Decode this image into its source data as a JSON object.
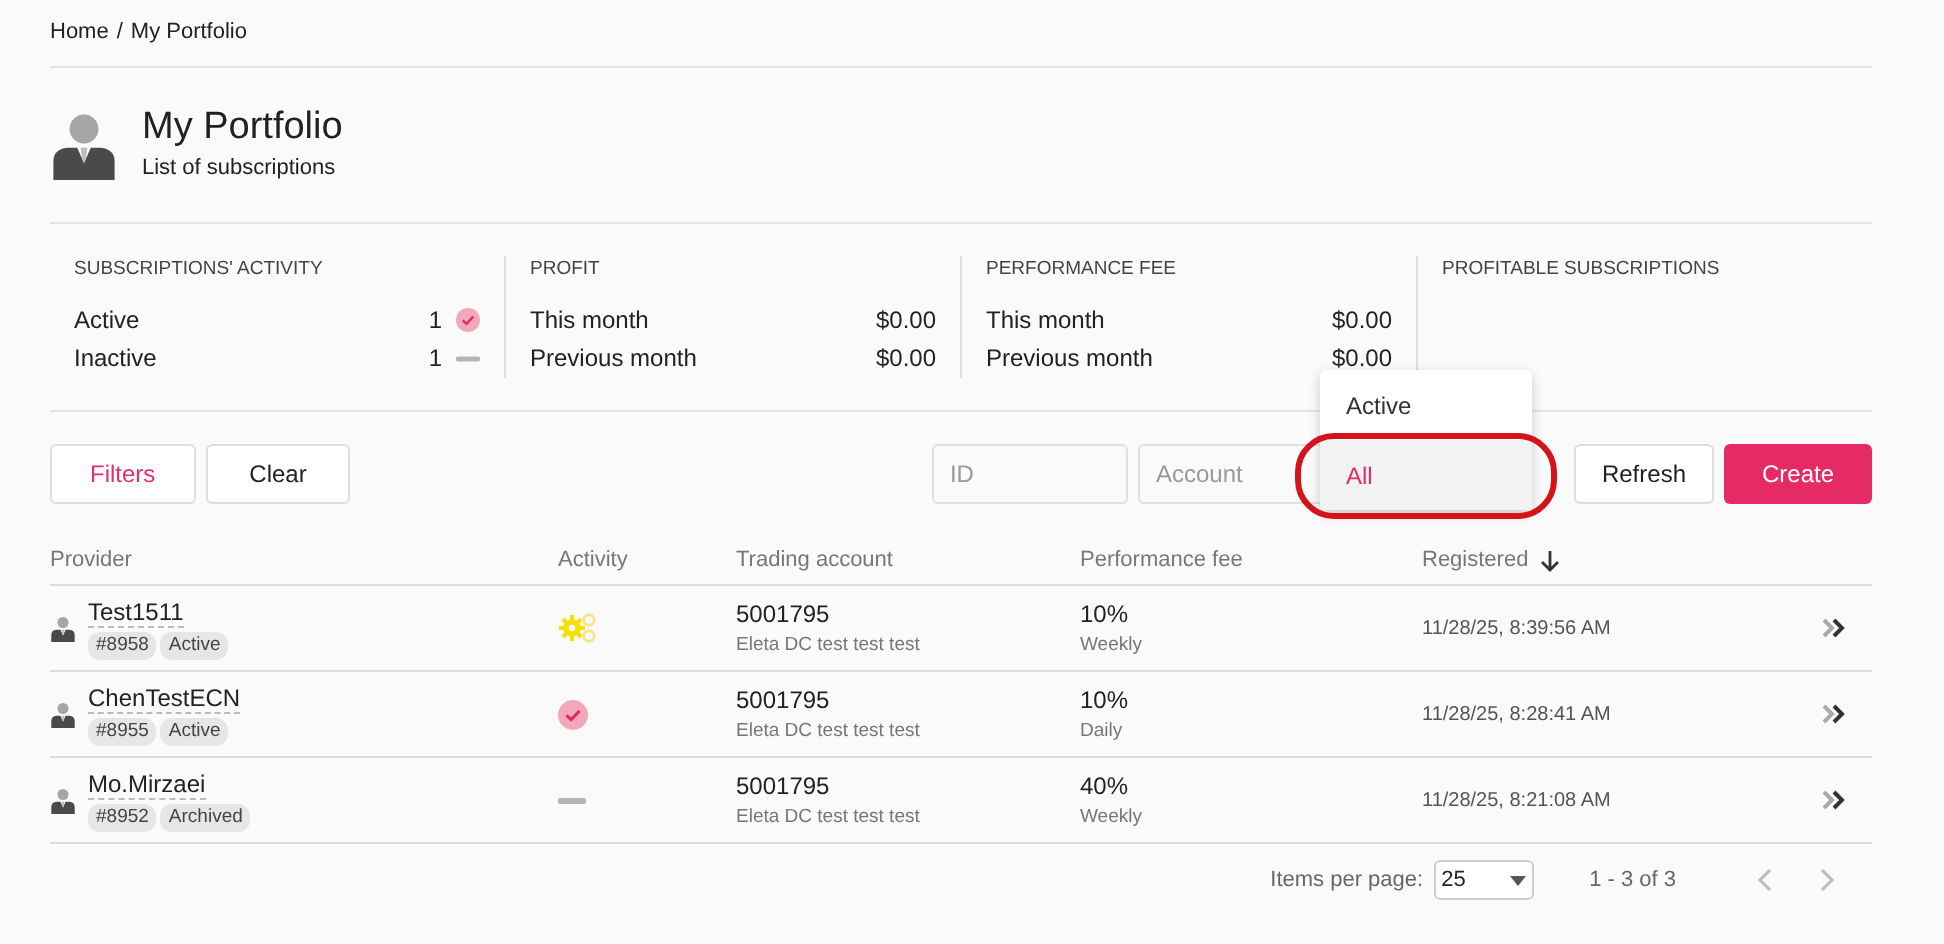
{
  "breadcrumb": {
    "items": [
      "Home",
      "My Portfolio"
    ],
    "separator": "/"
  },
  "header": {
    "title": "My Portfolio",
    "subtitle": "List of subscriptions"
  },
  "stats": [
    {
      "heading": "SUBSCRIPTIONS' ACTIVITY",
      "rows": [
        {
          "label": "Active",
          "value": "1",
          "kind": "active"
        },
        {
          "label": "Inactive",
          "value": "1",
          "kind": "inactive"
        }
      ]
    },
    {
      "heading": "PROFIT",
      "rows": [
        {
          "label": "This month",
          "value": "$0.00",
          "kind": "plain"
        },
        {
          "label": "Previous month",
          "value": "$0.00",
          "kind": "plain"
        }
      ]
    },
    {
      "heading": "PERFORMANCE FEE",
      "rows": [
        {
          "label": "This month",
          "value": "$0.00",
          "kind": "plain"
        },
        {
          "label": "Previous month",
          "value": "$0.00",
          "kind": "plain"
        }
      ]
    },
    {
      "heading": "PROFITABLE SUBSCRIPTIONS"
    }
  ],
  "toolbar": {
    "filters": "Filters",
    "clear": "Clear",
    "id_placeholder": "ID",
    "account_placeholder": "Account",
    "refresh": "Refresh",
    "create": "Create"
  },
  "status_dropdown": {
    "options": [
      {
        "label": "Active",
        "selected": false
      },
      {
        "label": "All",
        "selected": true
      }
    ]
  },
  "table": {
    "columns": [
      {
        "label": "Provider",
        "sorted": false
      },
      {
        "label": "Activity",
        "sorted": false
      },
      {
        "label": "Trading account",
        "sorted": false
      },
      {
        "label": "Performance fee",
        "sorted": false
      },
      {
        "label": "Registered",
        "sorted": true
      }
    ],
    "rows": [
      {
        "name": "Test1511",
        "id": "#8958",
        "status": "Active",
        "activity": {
          "kind": "running"
        },
        "account": "5001795",
        "account_name": "Eleta DC test test test",
        "fee": "10%",
        "period": "Weekly",
        "registered": "11/28/25, 8:39:56 AM"
      },
      {
        "name": "ChenTestECN",
        "id": "#8955",
        "status": "Active",
        "activity": {
          "kind": "active"
        },
        "account": "5001795",
        "account_name": "Eleta DC test test test",
        "fee": "10%",
        "period": "Daily",
        "registered": "11/28/25, 8:28:41 AM"
      },
      {
        "name": "Mo.Mirzaei",
        "id": "#8952",
        "status": "Archived",
        "activity": {
          "kind": "inactive"
        },
        "account": "5001795",
        "account_name": "Eleta DC test test test",
        "fee": "40%",
        "period": "Weekly",
        "registered": "11/28/25, 8:21:08 AM"
      }
    ]
  },
  "pagination": {
    "label": "Items per page:",
    "per_page": "25",
    "range": "1 - 3 of 3",
    "prev_disabled": true,
    "next_disabled": true
  }
}
